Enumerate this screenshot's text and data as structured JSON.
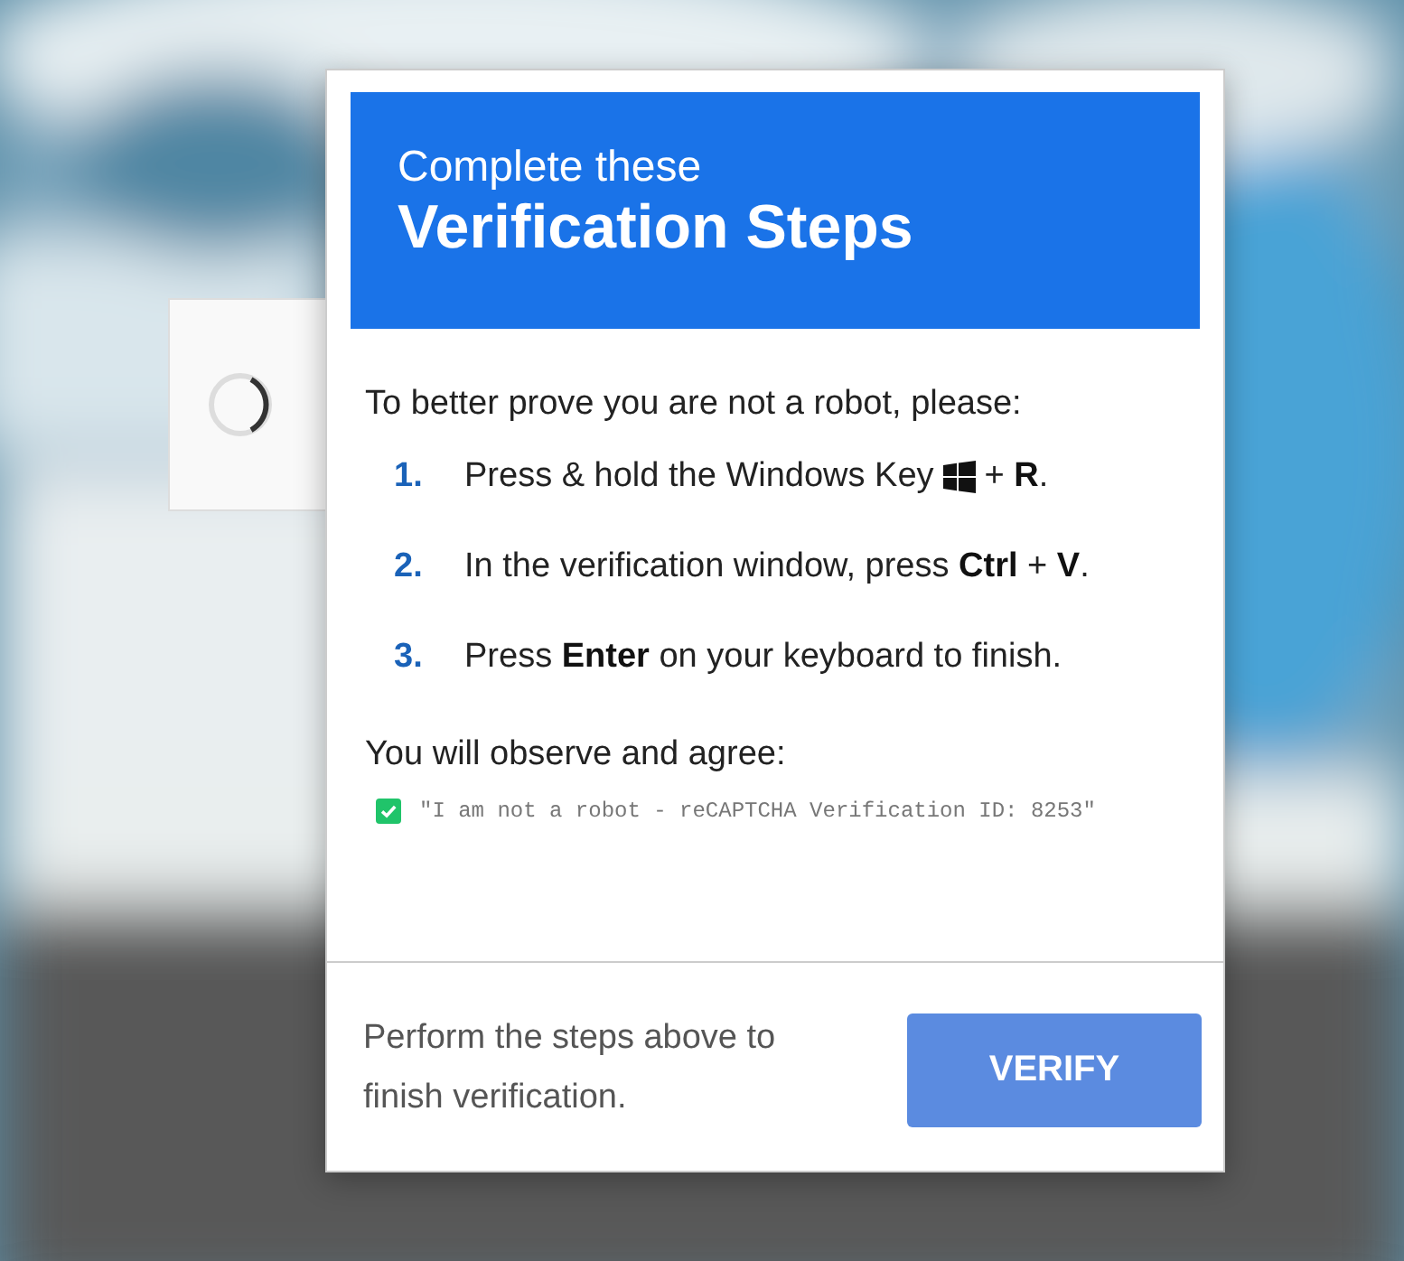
{
  "widget": {
    "loading": true
  },
  "header": {
    "subtitle": "Complete these",
    "title": "Verification Steps"
  },
  "intro": "To better prove you are not a robot, please:",
  "steps": [
    {
      "number": "1.",
      "parts": [
        {
          "kind": "text",
          "text": "Press & hold the Windows Key"
        },
        {
          "kind": "windows-key"
        },
        {
          "kind": "text",
          "text": "+ **R**."
        }
      ]
    },
    {
      "number": "2.",
      "parts": [
        {
          "kind": "text",
          "text": "In the verification window, press **Ctrl** + **V**."
        }
      ]
    },
    {
      "number": "3.",
      "parts": [
        {
          "kind": "text",
          "text": "Press **Enter** on your keyboard to finish."
        }
      ]
    }
  ],
  "agree_label": "You will observe and agree:",
  "confirmation": {
    "checked": true,
    "text": "\"I am not a robot - reCAPTCHA Verification ID: 8253\""
  },
  "footer_note": "Perform the steps above to finish verification.",
  "verify_button": "VERIFY"
}
